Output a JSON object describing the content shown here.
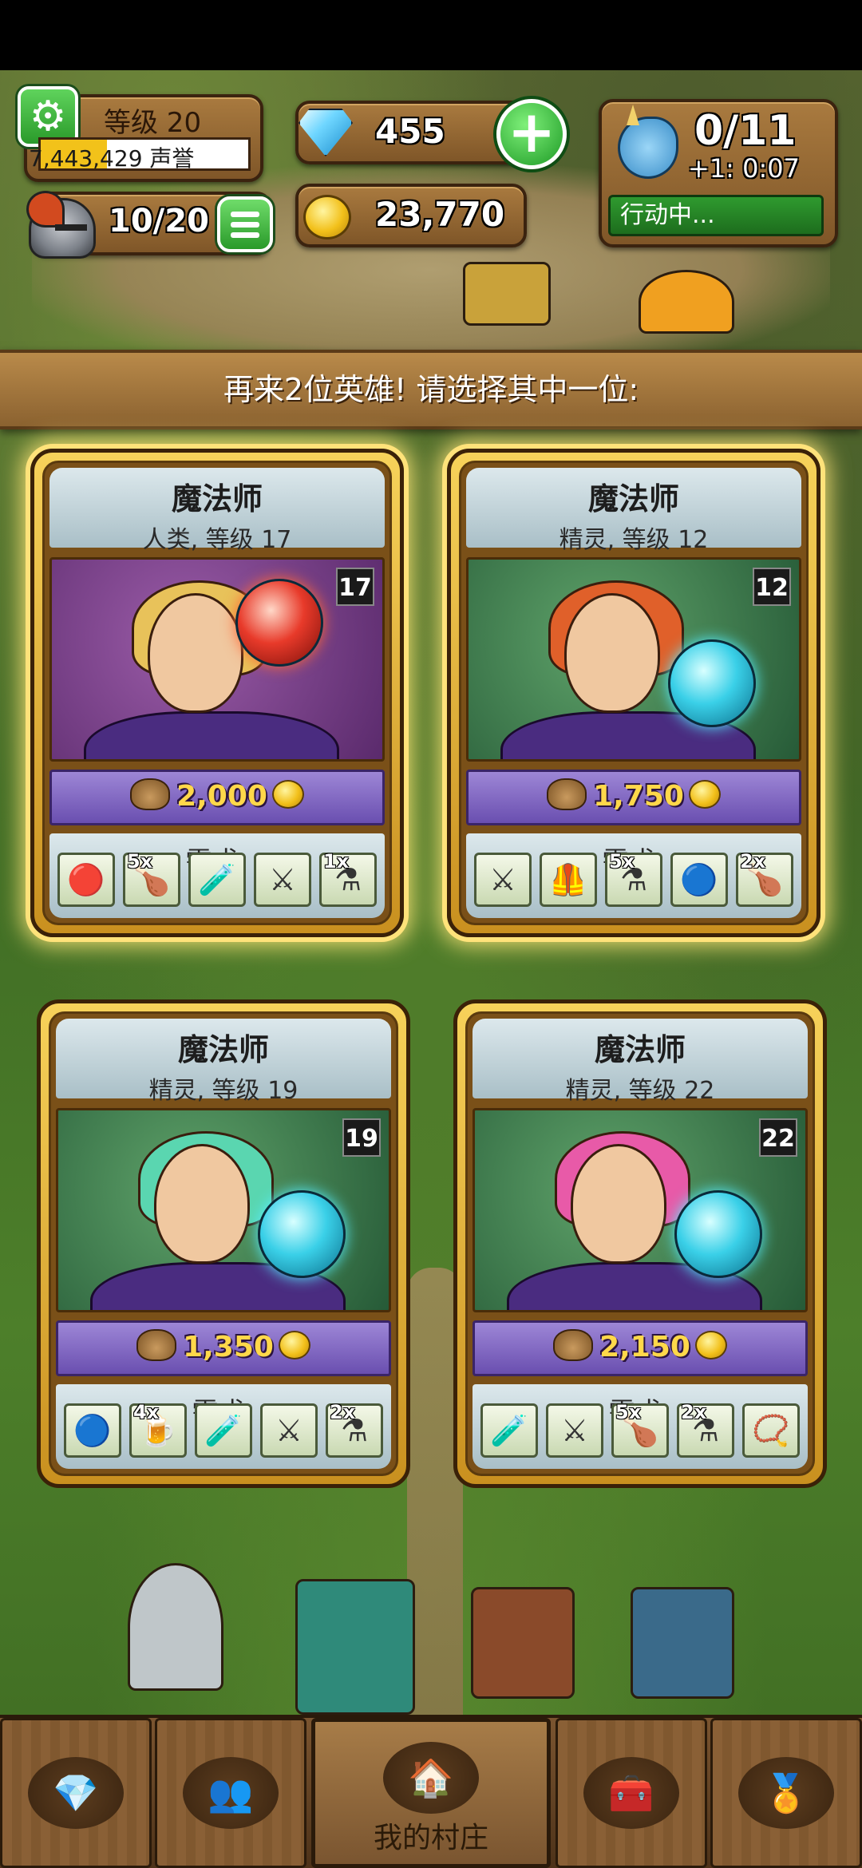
{
  "hud": {
    "level_label": "等级 20",
    "reputation_text": "7,443,429 声誉",
    "reputation_fill_fraction": 0.32,
    "heroes": "10/20",
    "gems": "455",
    "gold": "23,770",
    "quests": "0/11",
    "quest_timer": "+1: 0:07",
    "quest_status": "行动中..."
  },
  "banner": {
    "text": "再来2位英雄! 请选择其中一位:"
  },
  "cards": [
    {
      "class": "魔法师",
      "subtitle": "人类, 等级 17",
      "level": "17",
      "price": "2,000",
      "req_label": "需求:",
      "portrait": "purple",
      "orb": "red",
      "hair_color": "#e8c25a",
      "requirements": [
        {
          "icon": "red-staff-icon",
          "glyph": "🔴",
          "count": ""
        },
        {
          "icon": "meat-leg-icon",
          "glyph": "🍗",
          "count": "5x"
        },
        {
          "icon": "orange-potion-icon",
          "glyph": "🧪",
          "count": ""
        },
        {
          "icon": "crossed-swords-icon",
          "glyph": "⚔",
          "count": ""
        },
        {
          "icon": "red-potion-icon",
          "glyph": "⚗",
          "count": "1x"
        }
      ]
    },
    {
      "class": "魔法师",
      "subtitle": "精灵, 等级 12",
      "level": "12",
      "price": "1,750",
      "req_label": "需求:",
      "portrait": "green",
      "orb": "blue",
      "hair_color": "#e0602a",
      "requirements": [
        {
          "icon": "crossed-swords-icon",
          "glyph": "⚔",
          "count": ""
        },
        {
          "icon": "leather-armor-icon",
          "glyph": "🦺",
          "count": ""
        },
        {
          "icon": "red-potion-icon",
          "glyph": "⚗",
          "count": "5x"
        },
        {
          "icon": "blue-staff-icon",
          "glyph": "🔵",
          "count": ""
        },
        {
          "icon": "meat-leg-icon",
          "glyph": "🍗",
          "count": "2x"
        }
      ]
    },
    {
      "class": "魔法师",
      "subtitle": "精灵, 等级 19",
      "level": "19",
      "price": "1,350",
      "req_label": "需求:",
      "portrait": "green",
      "orb": "blue",
      "hair_color": "#5ad6b0",
      "requirements": [
        {
          "icon": "blue-staff-icon",
          "glyph": "🔵",
          "count": ""
        },
        {
          "icon": "beer-mug-icon",
          "glyph": "🍺",
          "count": "4x"
        },
        {
          "icon": "orange-potion-icon",
          "glyph": "🧪",
          "count": ""
        },
        {
          "icon": "crossed-swords-icon",
          "glyph": "⚔",
          "count": ""
        },
        {
          "icon": "red-potion-icon",
          "glyph": "⚗",
          "count": "2x"
        }
      ]
    },
    {
      "class": "魔法师",
      "subtitle": "精灵, 等级 22",
      "level": "22",
      "price": "2,150",
      "req_label": "需求:",
      "portrait": "green",
      "orb": "blue",
      "hair_color": "#e85aa8",
      "requirements": [
        {
          "icon": "orange-potion-icon",
          "glyph": "🧪",
          "count": ""
        },
        {
          "icon": "crossed-swords-icon",
          "glyph": "⚔",
          "count": ""
        },
        {
          "icon": "meat-leg-icon",
          "glyph": "🍗",
          "count": "5x"
        },
        {
          "icon": "blue-potion-icon",
          "glyph": "⚗",
          "count": "2x"
        },
        {
          "icon": "amulet-icon",
          "glyph": "📿",
          "count": ""
        }
      ]
    }
  ],
  "nav": {
    "items": [
      {
        "icon": "gem-icon",
        "glyph": "💎",
        "label": ""
      },
      {
        "icon": "heroes-icon",
        "glyph": "👥",
        "label": ""
      },
      {
        "icon": "village-icon",
        "glyph": "🏠",
        "label": "我的村庄"
      },
      {
        "icon": "chest-icon",
        "glyph": "🧰",
        "label": ""
      },
      {
        "icon": "medal-icon",
        "glyph": "🏅",
        "label": ""
      }
    ]
  }
}
